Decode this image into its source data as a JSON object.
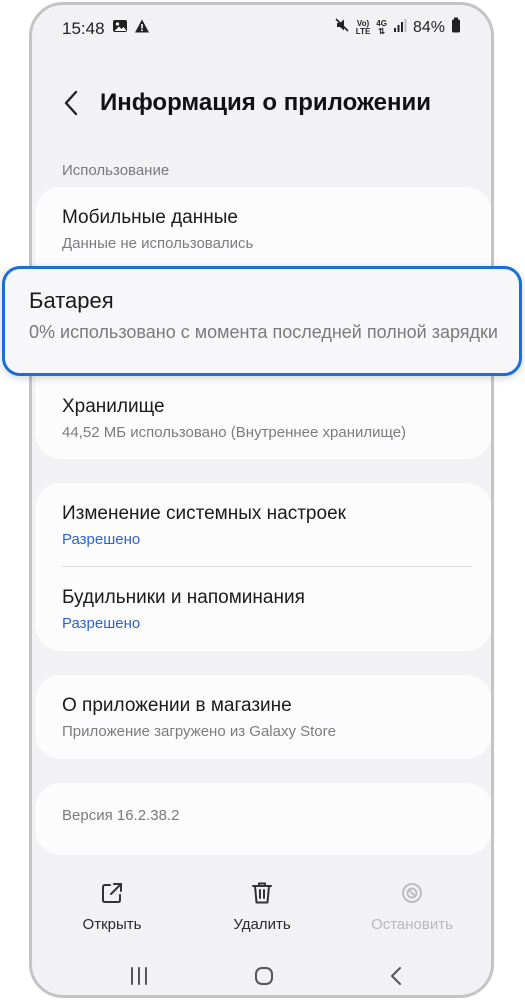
{
  "status_bar": {
    "time": "15:48",
    "battery": "84%",
    "net_top": "Vo)",
    "net_bottom": "LTE",
    "net_gen": "4G",
    "left_icons": [
      "image-icon",
      "warning-icon"
    ],
    "right_icons": [
      "mute-icon",
      "volte-icon",
      "4g-icon",
      "signal-icon",
      "battery-icon"
    ]
  },
  "header": {
    "title": "Информация о приложении"
  },
  "usage": {
    "section_label": "Использование",
    "mobile_data": {
      "title": "Мобильные данные",
      "subtitle": "Данные не использовались"
    },
    "battery": {
      "title": "Батарея",
      "subtitle": "0% использовано с момента последней полной зарядки"
    },
    "storage": {
      "title": "Хранилище",
      "subtitle": "44,52 МБ использовано (Внутреннее хранилище)"
    }
  },
  "permissions": {
    "system_settings": {
      "title": "Изменение системных настроек",
      "subtitle": "Разрешено"
    },
    "alarms": {
      "title": "Будильники и напоминания",
      "subtitle": "Разрешено"
    }
  },
  "store": {
    "title": "О приложении в магазине",
    "subtitle": "Приложение загружено из Galaxy Store"
  },
  "version": "Версия 16.2.38.2",
  "actions": {
    "open": "Открыть",
    "delete": "Удалить",
    "stop": "Остановить"
  },
  "colors": {
    "accent_blue": "#2f63c9",
    "highlight_border": "#1a6fd6",
    "background": "#f2f2f5"
  }
}
